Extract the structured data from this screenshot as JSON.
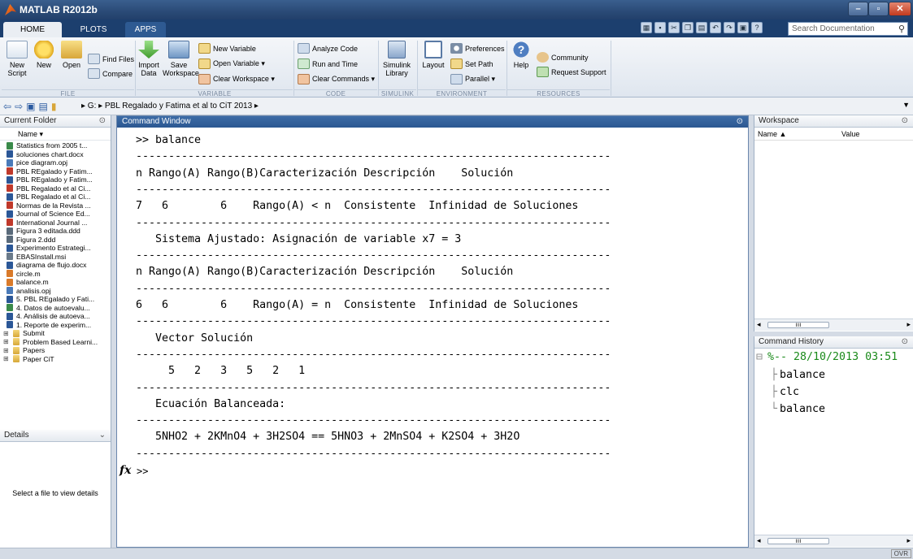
{
  "window": {
    "title": "MATLAB R2012b"
  },
  "tabs": [
    "HOME",
    "PLOTS",
    "APPS"
  ],
  "search": {
    "placeholder": "Search Documentation"
  },
  "ribbon": {
    "new_script": "New\nScript",
    "new": "New",
    "open": "Open",
    "find_files": "Find Files",
    "compare": "Compare",
    "import_data": "Import\nData",
    "save_workspace": "Save\nWorkspace",
    "new_variable": "New Variable",
    "open_variable": "Open Variable ▾",
    "clear_workspace": "Clear Workspace ▾",
    "analyze_code": "Analyze Code",
    "run_and_time": "Run and Time",
    "clear_commands": "Clear Commands ▾",
    "simulink_library": "Simulink\nLibrary",
    "layout": "Layout",
    "preferences": "Preferences",
    "set_path": "Set Path",
    "parallel": "Parallel ▾",
    "help": "Help",
    "community": "Community",
    "request_support": "Request Support",
    "groups": {
      "file": "FILE",
      "variable": "VARIABLE",
      "code": "CODE",
      "simulink": "SIMULINK",
      "environment": "ENVIRONMENT",
      "resources": "RESOURCES"
    }
  },
  "address": {
    "path": "▸ G: ▸ PBL Regalado y Fatima  et al to CiT 2013 ▸"
  },
  "current_folder": {
    "title": "Current Folder",
    "name_col": "Name ▾",
    "files": [
      {
        "name": "Statistics from 2005  t...",
        "color": "#3a8a4a"
      },
      {
        "name": "soluciones chart.docx",
        "color": "#2b5797"
      },
      {
        "name": "pice diagram.opj",
        "color": "#4a7ab8"
      },
      {
        "name": "PBL REgalado y Fatim...",
        "color": "#c0392b"
      },
      {
        "name": "PBL REgalado y Fatim...",
        "color": "#2b5797"
      },
      {
        "name": "PBL Regalado et al Ci...",
        "color": "#c0392b"
      },
      {
        "name": "PBL Regalado et al Ci...",
        "color": "#2b5797"
      },
      {
        "name": "Normas de la Revista ...",
        "color": "#c0392b"
      },
      {
        "name": "Journal of Science Ed...",
        "color": "#2b5797"
      },
      {
        "name": "International Journal ...",
        "color": "#c0392b"
      },
      {
        "name": "Figura 3 editada.ddd",
        "color": "#5a6a7a"
      },
      {
        "name": "Figura 2.ddd",
        "color": "#5a6a7a"
      },
      {
        "name": "Experimento Estrategi...",
        "color": "#2b5797"
      },
      {
        "name": "EBASInstall.msi",
        "color": "#6a7a8a"
      },
      {
        "name": "diagrama de flujo.docx",
        "color": "#2b5797"
      },
      {
        "name": "circle.m",
        "color": "#d97a2a"
      },
      {
        "name": "balance.m",
        "color": "#d97a2a"
      },
      {
        "name": "analisis.opj",
        "color": "#4a7ab8"
      },
      {
        "name": "5. PBL REgalado y Fati...",
        "color": "#2b5797"
      },
      {
        "name": "4. Datos de autoevalu...",
        "color": "#3a8a4a"
      },
      {
        "name": "4. Análisis de autoeva...",
        "color": "#2b5797"
      },
      {
        "name": "1. Reporte de experim...",
        "color": "#2b5797"
      }
    ],
    "folders": [
      "Submit",
      "Problem Based Learni...",
      "Papers",
      "Paper CiT"
    ]
  },
  "details": {
    "title": "Details",
    "text": "Select a file to view details"
  },
  "command_window": {
    "title": "Command Window",
    "lines": [
      ">> balance",
      "-------------------------------------------------------------------------",
      "n Rango(A) Rango(B)Caracterización Descripción    Solución",
      "-------------------------------------------------------------------------",
      "7   6        6    Rango(A) < n  Consistente  Infinidad de Soluciones",
      "-------------------------------------------------------------------------",
      "   Sistema Ajustado: Asignación de variable x7 = 3",
      "-------------------------------------------------------------------------",
      "n Rango(A) Rango(B)Caracterización Descripción    Solución",
      "-------------------------------------------------------------------------",
      "6   6        6    Rango(A) = n  Consistente  Infinidad de Soluciones",
      "-------------------------------------------------------------------------",
      "   Vector Solución",
      "-------------------------------------------------------------------------",
      "     5   2   3   5   2   1",
      "-------------------------------------------------------------------------",
      "   Ecuación Balanceada:",
      "-------------------------------------------------------------------------",
      "   5NHO2 + 2KMnO4 + 3H2SO4 == 5HNO3 + 2MnSO4 + K2SO4 + 3H2O",
      "-------------------------------------------------------------------------"
    ],
    "prompt": ">>"
  },
  "workspace": {
    "title": "Workspace",
    "name_col": "Name ▲",
    "value_col": "Value"
  },
  "command_history": {
    "title": "Command History",
    "session": "%-- 28/10/2013 03:51",
    "entries": [
      "balance",
      "clc",
      "balance"
    ]
  },
  "status": {
    "ovr": "OVR"
  }
}
